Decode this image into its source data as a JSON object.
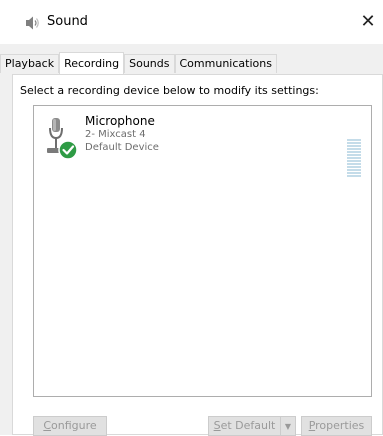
{
  "window": {
    "title": "Sound",
    "close_glyph": "✕"
  },
  "tabs": [
    {
      "label": "Playback",
      "active": false
    },
    {
      "label": "Recording",
      "active": true
    },
    {
      "label": "Sounds",
      "active": false
    },
    {
      "label": "Communications",
      "active": false
    }
  ],
  "instruction": "Select a recording device below to modify its settings:",
  "devices": [
    {
      "name": "Microphone",
      "description": "2- Mixcast 4",
      "status": "Default Device",
      "icon": "microphone-icon",
      "badge_icon": "default-check-icon",
      "level_meter": 0
    }
  ],
  "buttons": {
    "configure": {
      "before": "",
      "accel": "C",
      "after": "onfigure",
      "enabled": false
    },
    "set_default": {
      "before": "",
      "accel": "S",
      "after": "et Default",
      "enabled": false
    },
    "set_default_dropdown": {
      "glyph": "▼",
      "enabled": false
    },
    "properties": {
      "before": "",
      "accel": "P",
      "after": "roperties",
      "enabled": false
    }
  },
  "colors": {
    "accent_green": "#2e9b45",
    "disabled_text": "#9a9a9a",
    "meter": "#c4dce9"
  }
}
